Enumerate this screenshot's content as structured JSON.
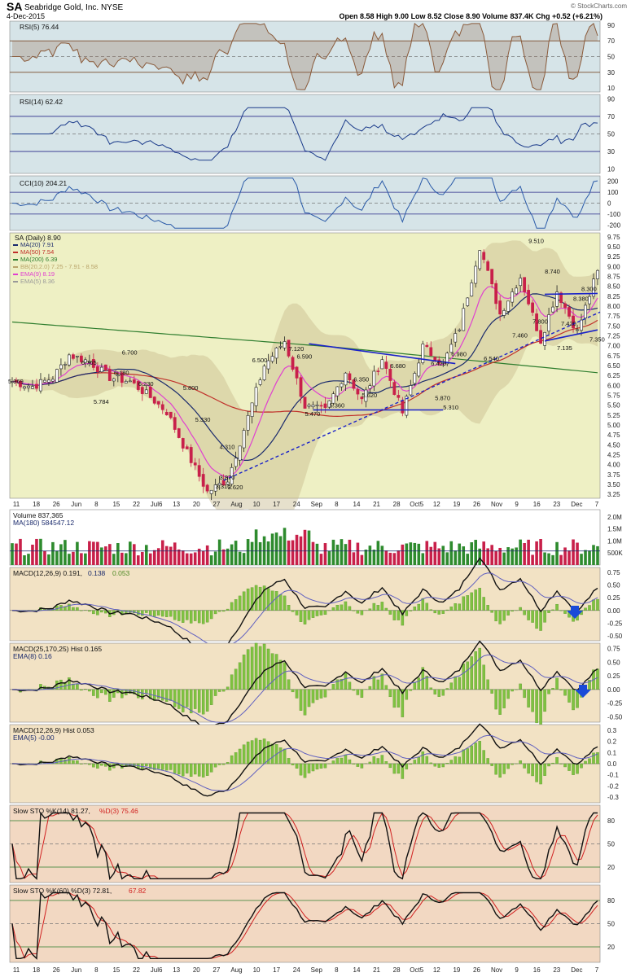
{
  "header": {
    "ticker": "SA",
    "company": "Seabridge Gold, Inc. NYSE",
    "date": "4-Dec-2015",
    "quote": "Open 8.58  High 9.00  Low 8.52  Close 8.90  Volume 837.4K  Chg +0.52 (+6.21%)",
    "watermark": "© StockCharts.com"
  },
  "colors": {
    "bg_rsi": "#d6e4e8",
    "bg_price": "#eef0c4",
    "bg_volume": "#ffffff",
    "bg_macd": "#f2e2c4",
    "bg_sto": "#f2d8c2",
    "up_vol": "#2e8b2e",
    "down_vol": "#c8204a",
    "hist_fill": "#7fc241",
    "ma20": "#1a2a6c",
    "ma50": "#c0302a",
    "ma200": "#2e7d2e",
    "ema9": "#e040d0",
    "bb_fill": "#c8bb8f",
    "trend": "#1a22c8"
  },
  "x_axis": {
    "labels": [
      "11",
      "18",
      "26",
      "Jun",
      "8",
      "15",
      "22",
      "Jul6",
      "13",
      "20",
      "27",
      "Aug",
      "10",
      "17",
      "24",
      "Sep",
      "8",
      "14",
      "21",
      "28",
      "Oct5",
      "12",
      "19",
      "26",
      "Nov",
      "9",
      "16",
      "23",
      "Dec",
      "7"
    ]
  },
  "panels": {
    "rsi5": {
      "title": "RSI(5) 76.44",
      "ticks": [
        "90",
        "70",
        "50",
        "30",
        "10"
      ]
    },
    "rsi14": {
      "title": "RSI(14) 62.42",
      "ticks": [
        "90",
        "70",
        "50",
        "30",
        "10"
      ]
    },
    "cci": {
      "title": "CCI(10) 204.21",
      "ticks": [
        "200",
        "100",
        "0",
        "-100",
        "-200"
      ]
    },
    "price": {
      "title": "SA (Daily) 8.90",
      "legend": [
        {
          "text": "MA(20) 7.91",
          "color": "#1a2a6c"
        },
        {
          "text": "MA(50) 7.54",
          "color": "#c0302a"
        },
        {
          "text": "MA(200) 6.39",
          "color": "#2e7d2e"
        },
        {
          "text": "BB(20,2.0) 7.25 - 7.91 - 8.58",
          "color": "#b9a46a"
        },
        {
          "text": "EMA(9) 8.19",
          "color": "#e040d0"
        },
        {
          "text": "EMA(5) 8.36",
          "color": "#999999"
        }
      ],
      "ticks": [
        "9.75",
        "9.50",
        "9.25",
        "9.00",
        "8.75",
        "8.50",
        "8.25",
        "8.00",
        "7.75",
        "7.50",
        "7.25",
        "7.00",
        "6.75",
        "6.50",
        "6.25",
        "6.00",
        "5.75",
        "5.50",
        "5.25",
        "5.00",
        "4.75",
        "4.50",
        "4.25",
        "4.00",
        "3.75",
        "3.50",
        "3.25"
      ],
      "annotations": [
        "5.969",
        "6.765",
        "6.700",
        "5.784",
        "6.180",
        "6.230",
        "5.800",
        "5.330",
        "4.310",
        "3.870",
        "3.310",
        "3.620",
        "6.500",
        "7.120",
        "6.590",
        "5.470",
        "5.360",
        "6.350",
        "5.620",
        "6.680",
        "6.420",
        "5.870",
        "5.310",
        "6.980",
        "6.540",
        "7.460",
        "9.510",
        "7.800",
        "8.740",
        "7.135",
        "7.420",
        "8.380",
        "8.300",
        "7.350"
      ]
    },
    "volume": {
      "title": "Volume 837,365",
      "sub": "MA(180) 584547.12",
      "ticks": [
        "2.0M",
        "1.5M",
        "1.0M",
        "500K"
      ]
    },
    "macd1": {
      "title_a": "MACD(12,26,9) 0.191, ",
      "title_b": "0.138",
      "title_c": "0.053",
      "ticks": [
        "0.75",
        "0.50",
        "0.25",
        "0.00",
        "-0.25",
        "-0.50"
      ]
    },
    "macd2": {
      "title": "MACD(25,170,25) Hist 0.165",
      "sub": "EMA(8) 0.16",
      "ticks": [
        "0.75",
        "0.50",
        "0.25",
        "0.00",
        "-0.25",
        "-0.50"
      ]
    },
    "macd3": {
      "title": "MACD(12,26,9) Hist 0.053",
      "sub": "EMA(5) -0.00",
      "ticks": [
        "0.3",
        "0.2",
        "0.1",
        "0.0",
        "-0.1",
        "-0.2",
        "-0.3"
      ]
    },
    "sto14": {
      "title_a": "Slow STO %K(14) 81.27, ",
      "title_b": "%D(3) 75.46",
      "ticks": [
        "80",
        "50",
        "20"
      ]
    },
    "sto60": {
      "title_a": "Slow STO %K(60) %D(3) 72.81, ",
      "title_b": "67.82",
      "ticks": [
        "80",
        "50",
        "20"
      ]
    }
  },
  "chart_data": {
    "type": "line",
    "title": "SA (Daily) 8.90",
    "x_labels": [
      "11",
      "18",
      "26",
      "Jun",
      "8",
      "15",
      "22",
      "Jul6",
      "13",
      "20",
      "27",
      "Aug",
      "10",
      "17",
      "24",
      "Sep",
      "8",
      "14",
      "21",
      "28",
      "Oct5",
      "12",
      "19",
      "26",
      "Nov",
      "9",
      "16",
      "23",
      "Dec",
      "7"
    ],
    "close_key_points": [
      6.1,
      5.97,
      6.2,
      6.77,
      6.6,
      6.2,
      6.1,
      5.7,
      5.33,
      4.3,
      3.31,
      3.62,
      5.2,
      6.5,
      7.12,
      5.47,
      5.36,
      6.35,
      5.62,
      6.68,
      5.31,
      6.98,
      6.54,
      7.46,
      9.51,
      7.8,
      8.74,
      7.135,
      8.38,
      7.35,
      8.9
    ],
    "ylim": [
      3.25,
      9.75
    ],
    "series": [
      {
        "name": "MA(20) 7.91"
      },
      {
        "name": "MA(50) 7.54"
      },
      {
        "name": "MA(200) 6.39"
      },
      {
        "name": "EMA(9) 8.19"
      }
    ],
    "volume_ylim": [
      0,
      2000000
    ],
    "volume_latest": 837365,
    "rsi5_latest": 76.44,
    "rsi14_latest": 62.42,
    "cci_latest": 204.21,
    "macd_latest": [
      0.191,
      0.138,
      0.053
    ],
    "sto14_latest": [
      81.27,
      75.46
    ],
    "sto60_latest": [
      72.81,
      67.82
    ]
  }
}
